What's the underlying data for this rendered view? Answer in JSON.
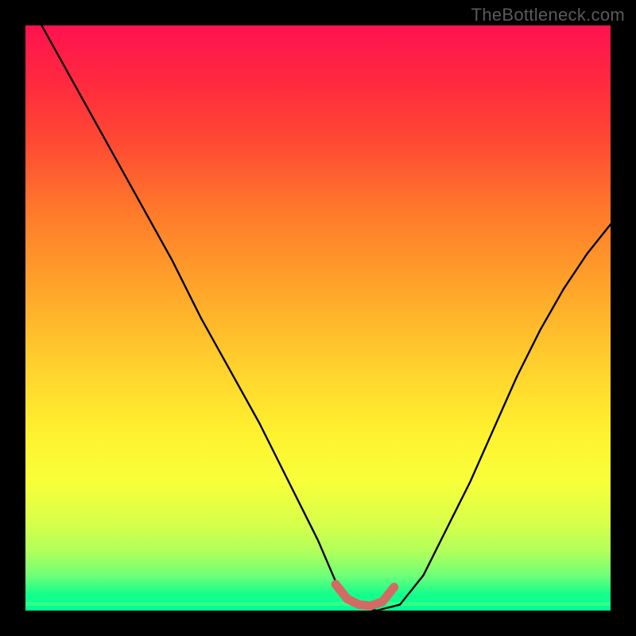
{
  "watermark": "TheBottleneck.com",
  "colors": {
    "curve": "#000000",
    "marker": "#d46a64",
    "background_frame": "#000000"
  },
  "chart_data": {
    "type": "line",
    "title": "",
    "xlabel": "",
    "ylabel": "",
    "xlim": [
      0,
      100
    ],
    "ylim": [
      0,
      100
    ],
    "series": [
      {
        "name": "bottleneck-curve",
        "x": [
          0,
          5,
          10,
          15,
          20,
          25,
          30,
          35,
          40,
          45,
          50,
          53,
          56,
          60,
          64,
          68,
          72,
          76,
          80,
          84,
          88,
          92,
          96,
          100
        ],
        "values": [
          105,
          96,
          87,
          78,
          69,
          60,
          50,
          41,
          32,
          22,
          12,
          5,
          1,
          0,
          1,
          6,
          14,
          22,
          31,
          40,
          48,
          55,
          61,
          66
        ]
      }
    ],
    "markers": {
      "name": "optimal-range",
      "x": [
        53,
        55,
        57,
        59,
        61,
        63
      ],
      "values": [
        4.5,
        2.0,
        1.0,
        0.8,
        1.5,
        4.0
      ]
    },
    "gradient_stops": [
      {
        "pos": 0.0,
        "color": "#ff1250"
      },
      {
        "pos": 0.5,
        "color": "#ffd02d"
      },
      {
        "pos": 0.8,
        "color": "#f7ff3a"
      },
      {
        "pos": 1.0,
        "color": "#00ff95"
      }
    ]
  }
}
